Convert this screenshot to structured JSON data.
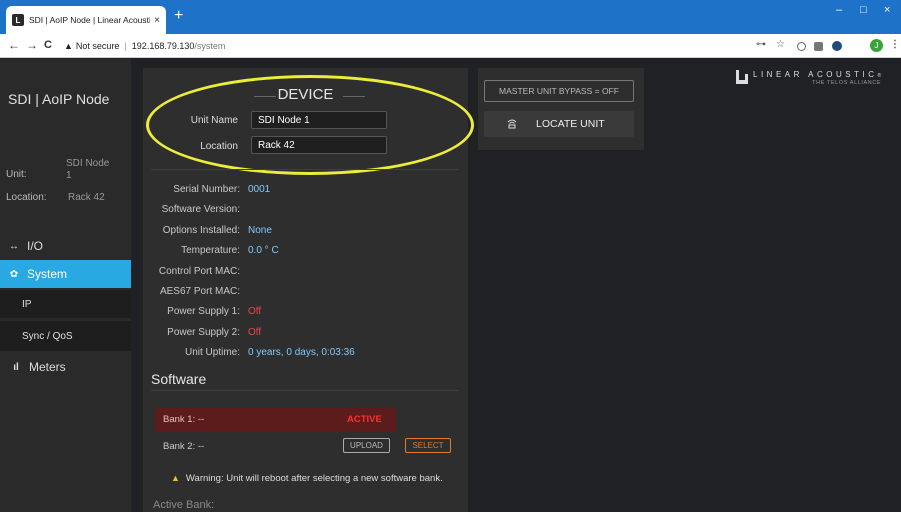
{
  "browser": {
    "tab_title": "SDI | AoIP Node | Linear Acoustic",
    "tab_close": "×",
    "new_tab": "+",
    "favicon": "L",
    "back": "←",
    "forward": "→",
    "reload": "C",
    "security_warning_icon": "▲",
    "security_label": "Not secure",
    "separator": "|",
    "host": "192.168.79.130",
    "path": "/system",
    "key_icon": "⊶",
    "star_icon": "☆",
    "minimize": "–",
    "maximize": "□",
    "close": "×",
    "profile_initial": "J",
    "menu_icon": "⋮"
  },
  "sidebar": {
    "title": "SDI | AoIP Node",
    "unit_label": "Unit:",
    "unit_value": "SDI Node 1",
    "location_label": "Location:",
    "location_value": "Rack 42",
    "nav": {
      "io": {
        "icon": "↔",
        "label": "I/O"
      },
      "system": {
        "icon": "✿",
        "label": "System"
      },
      "ip": {
        "label": "IP"
      },
      "sync": {
        "label": "Sync / QoS"
      },
      "meters": {
        "icon": "ıl",
        "label": "Meters"
      }
    }
  },
  "device": {
    "title": "DEVICE",
    "unit_name_label": "Unit Name",
    "unit_name_value": "SDI Node 1",
    "location_label": "Location",
    "location_value": "Rack 42",
    "info": [
      {
        "label": "Serial Number:",
        "value": "0001",
        "status": "normal"
      },
      {
        "label": "Software Version:",
        "value": "",
        "status": "normal"
      },
      {
        "label": "Options Installed:",
        "value": "None",
        "status": "normal"
      },
      {
        "label": "Temperature:",
        "value": "0.0 ° C",
        "status": "normal"
      },
      {
        "label": "Control Port MAC:",
        "value": "",
        "status": "normal"
      },
      {
        "label": "AES67 Port MAC:",
        "value": "",
        "status": "normal"
      },
      {
        "label": "Power Supply 1:",
        "value": "Off",
        "status": "error"
      },
      {
        "label": "Power Supply 2:",
        "value": "Off",
        "status": "error"
      },
      {
        "label": "Unit Uptime:",
        "value": "0 years, 0 days, 0:03:36",
        "status": "normal"
      }
    ]
  },
  "software": {
    "title": "Software",
    "bank1_label": "Bank 1:  --",
    "bank1_status": "ACTIVE",
    "bank2_label": "Bank 2:  --",
    "upload_label": "UPLOAD",
    "select_label": "SELECT",
    "warning_icon": "▲",
    "warning_text": "Warning: Unit will reboot after selecting a new software bank.",
    "active_bank_label": "Active Bank:"
  },
  "actions": {
    "bypass_label": "MASTER UNIT BYPASS = OFF",
    "locate_icon": "📶",
    "locate_label": "LOCATE UNIT"
  },
  "logo": {
    "main": "LINEAR ACOUSTIC",
    "reg": "®",
    "sub": "THE TELOS ALLIANCE"
  },
  "colors": {
    "accent": "#29a9e1",
    "error": "#e04a4a",
    "active": "#ff2e2e",
    "highlight_ellipse": "#ecec3a",
    "select": "#e07a2a"
  }
}
